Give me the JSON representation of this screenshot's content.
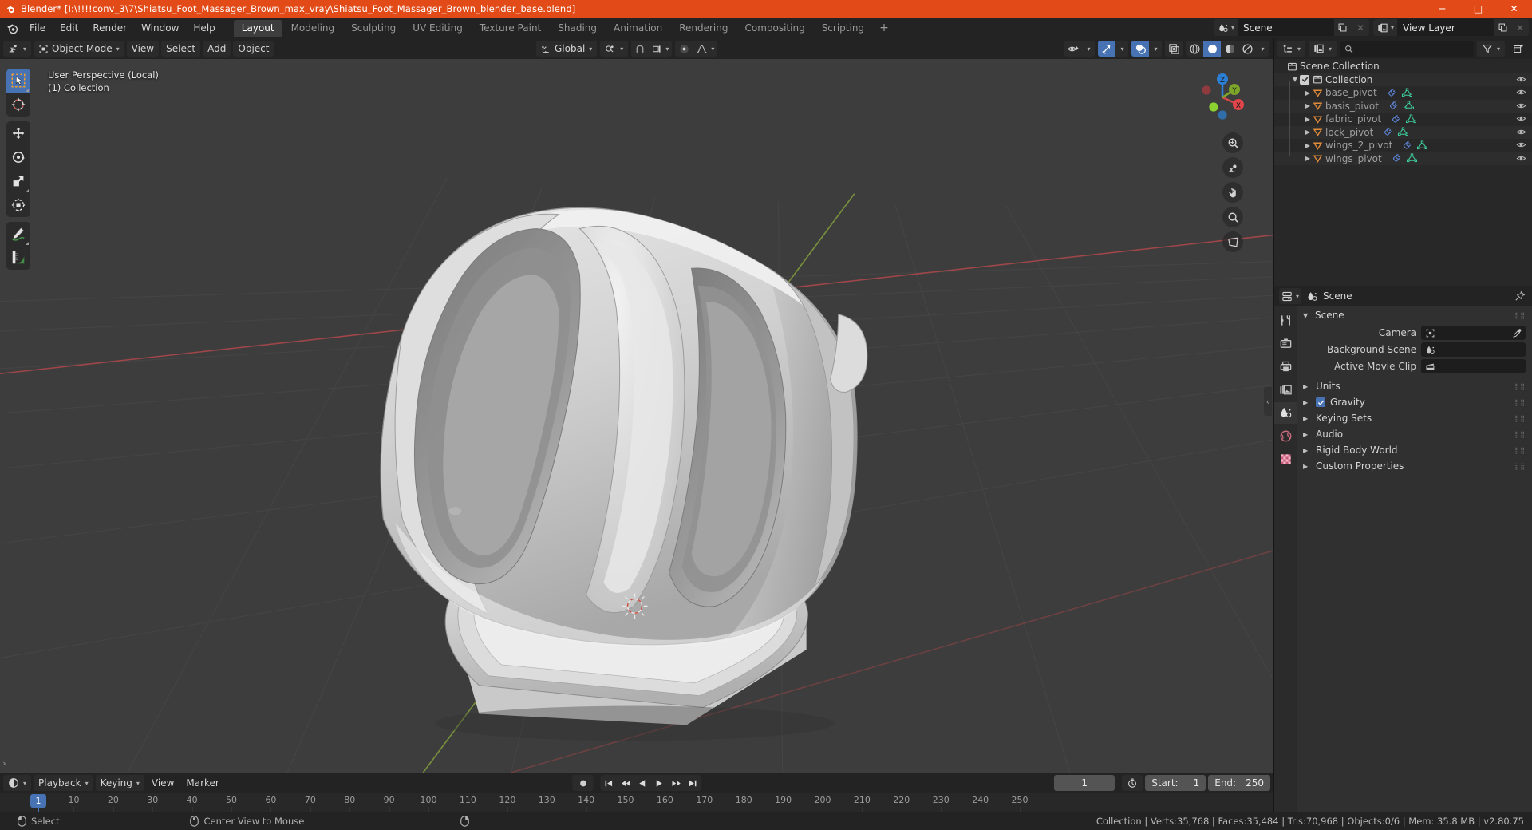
{
  "window": {
    "title": "Blender* [I:\\!!!!conv_3\\7\\Shiatsu_Foot_Massager_Brown_max_vray\\Shiatsu_Foot_Massager_Brown_blender_base.blend]",
    "app_icon": "blender-logo-icon",
    "minimize": "─",
    "maximize": "□",
    "close": "✕"
  },
  "topbar": {
    "menus": [
      "File",
      "Edit",
      "Render",
      "Window",
      "Help"
    ],
    "workspaces": [
      {
        "label": "Layout",
        "active": true
      },
      {
        "label": "Modeling",
        "active": false
      },
      {
        "label": "Sculpting",
        "active": false
      },
      {
        "label": "UV Editing",
        "active": false
      },
      {
        "label": "Texture Paint",
        "active": false
      },
      {
        "label": "Shading",
        "active": false
      },
      {
        "label": "Animation",
        "active": false
      },
      {
        "label": "Rendering",
        "active": false
      },
      {
        "label": "Compositing",
        "active": false
      },
      {
        "label": "Scripting",
        "active": false
      }
    ],
    "add_workspace": "+",
    "scene": {
      "icon": "scene-icon",
      "value": "Scene",
      "new_btn": "copy-icon",
      "unlink_btn": "✕"
    },
    "view_layer": {
      "icon": "view-layer-icon",
      "value": "View Layer",
      "new_btn": "copy-icon",
      "unlink_btn": "✕"
    }
  },
  "viewport_header": {
    "editor_type": "editor-type-3dview-icon",
    "mode": "Object Mode",
    "menus": [
      "View",
      "Select",
      "Add",
      "Object"
    ],
    "transform_orientation": "Global",
    "snap_icon": "magnet-icon",
    "proportional_icon": "proportional-edit-icon",
    "falloff_icon": "falloff-curve-icon",
    "pivot_icon": "pivot-point-icon",
    "visibility_icon": "show-hide-icon",
    "gizmo_icon": "gizmo-icon",
    "overlays_icon": "overlays-icon",
    "xray_icon": "xray-icon",
    "shading_modes": [
      "wireframe",
      "solid",
      "material-preview",
      "rendered"
    ],
    "shading_active_index": 1
  },
  "viewport": {
    "overlay_line1": "User Perspective (Local)",
    "overlay_line2": "(1) Collection",
    "tools": [
      {
        "name": "tweak-select-box-tool",
        "active": true
      },
      {
        "name": "cursor-tool",
        "active": false
      },
      {
        "name": "move-tool",
        "active": false
      },
      {
        "name": "rotate-tool",
        "active": false
      },
      {
        "name": "scale-tool",
        "active": false
      },
      {
        "name": "transform-tool",
        "active": false
      },
      {
        "name": "annotate-tool",
        "active": false
      },
      {
        "name": "measure-tool",
        "active": false
      }
    ],
    "gizmo_axes": [
      "X",
      "Y",
      "Z"
    ],
    "nav_buttons": [
      "zoom-camera-icon",
      "camera-view-icon",
      "move-view-icon",
      "zoom-view-icon",
      "toggle-perspective-icon"
    ],
    "collapse_arrow": "‹"
  },
  "outliner": {
    "display_mode_icon": "outliner-display-mode-icon",
    "filter_id_icon": "blender-file-icon",
    "search_placeholder": "",
    "search_icon": "search-icon",
    "filter_icon": "filter-icon",
    "new_collection_icon": "new-collection-icon",
    "rows": [
      {
        "label": "Scene Collection",
        "icon": "collection-icon",
        "depth": 0,
        "expandable": false,
        "checkbox": false,
        "eye": false,
        "data_icons": []
      },
      {
        "label": "Collection",
        "icon": "collection-icon",
        "depth": 1,
        "expandable": true,
        "expanded": true,
        "checkbox": true,
        "eye": true,
        "data_icons": []
      },
      {
        "label": "base_pivot",
        "icon": "empty-axes-icon",
        "depth": 2,
        "expandable": true,
        "expanded": false,
        "checkbox": false,
        "eye": true,
        "data_icons": [
          "modifier-icon",
          "mesh-data-icon"
        ]
      },
      {
        "label": "basis_pivot",
        "icon": "empty-axes-icon",
        "depth": 2,
        "expandable": true,
        "expanded": false,
        "checkbox": false,
        "eye": true,
        "data_icons": [
          "modifier-icon",
          "mesh-data-icon"
        ]
      },
      {
        "label": "fabric_pivot",
        "icon": "empty-axes-icon",
        "depth": 2,
        "expandable": true,
        "expanded": false,
        "checkbox": false,
        "eye": true,
        "data_icons": [
          "modifier-icon",
          "mesh-data-icon"
        ]
      },
      {
        "label": "lock_pivot",
        "icon": "empty-axes-icon",
        "depth": 2,
        "expandable": true,
        "expanded": false,
        "checkbox": false,
        "eye": true,
        "data_icons": [
          "modifier-icon",
          "mesh-data-icon"
        ]
      },
      {
        "label": "wings_2_pivot",
        "icon": "empty-axes-icon",
        "depth": 2,
        "expandable": true,
        "expanded": false,
        "checkbox": false,
        "eye": true,
        "data_icons": [
          "modifier-icon",
          "mesh-data-icon"
        ]
      },
      {
        "label": "wings_pivot",
        "icon": "empty-axes-icon",
        "depth": 2,
        "expandable": true,
        "expanded": false,
        "checkbox": false,
        "eye": true,
        "data_icons": [
          "modifier-icon",
          "mesh-data-icon"
        ]
      }
    ]
  },
  "properties": {
    "editor_icon": "properties-editor-icon",
    "breadcrumb_icon": "scene-icon",
    "breadcrumb": "Scene",
    "pin_icon": "pin-icon",
    "tabs": [
      {
        "name": "tool-tab",
        "active": false
      },
      {
        "name": "render-tab",
        "active": false
      },
      {
        "name": "output-tab",
        "active": false
      },
      {
        "name": "view-layer-tab",
        "active": false
      },
      {
        "name": "scene-tab",
        "active": true
      },
      {
        "name": "world-tab",
        "active": false
      },
      {
        "name": "texture-tab",
        "active": false
      }
    ],
    "panel_title": "Scene",
    "fields": [
      {
        "label": "Camera",
        "icon": "camera-data-icon",
        "value": "",
        "eyedropper": true
      },
      {
        "label": "Background Scene",
        "icon": "scene-icon",
        "value": "",
        "eyedropper": false
      },
      {
        "label": "Active Movie Clip",
        "icon": "movie-clip-icon",
        "value": "",
        "eyedropper": false
      }
    ],
    "sections": [
      {
        "label": "Units",
        "checkbox": false
      },
      {
        "label": "Gravity",
        "checkbox": true,
        "checked": true
      },
      {
        "label": "Keying Sets",
        "checkbox": false
      },
      {
        "label": "Audio",
        "checkbox": false
      },
      {
        "label": "Rigid Body World",
        "checkbox": false
      },
      {
        "label": "Custom Properties",
        "checkbox": false
      }
    ]
  },
  "timeline": {
    "editor_icon": "timeline-editor-icon",
    "menus": [
      "Playback",
      "Keying",
      "View",
      "Marker"
    ],
    "record_icon": "record-icon",
    "transport": [
      "jump-start-icon",
      "prev-keyframe-icon",
      "play-reverse-icon",
      "play-icon",
      "next-keyframe-icon",
      "jump-end-icon"
    ],
    "current_frame": "1",
    "autokey_icon": "auto-keying-icon",
    "start_label": "Start:",
    "start_value": "1",
    "end_label": "End:",
    "end_value": "250",
    "ticks": [
      "10",
      "20",
      "30",
      "40",
      "50",
      "60",
      "70",
      "80",
      "90",
      "100",
      "110",
      "120",
      "130",
      "140",
      "150",
      "160",
      "170",
      "180",
      "190",
      "200",
      "210",
      "220",
      "230",
      "240",
      "250"
    ],
    "playhead_label": "1"
  },
  "statusbar": {
    "items": [
      {
        "icon": "mouse-left-icon",
        "label": "Select"
      },
      {
        "icon": "mouse-middle-icon",
        "label": "Center View to Mouse"
      },
      {
        "icon": "mouse-right-icon",
        "label": ""
      }
    ],
    "stats": "Collection | Verts:35,768 | Faces:35,484 | Tris:70,968 | Objects:0/6 | Mem: 35.8 MB | v2.80.75"
  },
  "colors": {
    "accent": "#4772b3",
    "title_bar": "#e24b18",
    "viewport_bg": "#3d3d3d",
    "x_axis": "#c1453f",
    "y_axis": "#8ab52a",
    "z_axis": "#2b7fd4"
  }
}
